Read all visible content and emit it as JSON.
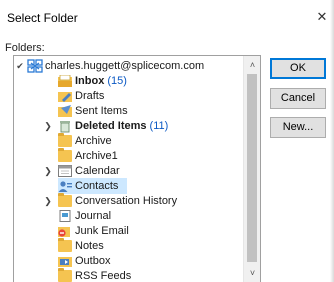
{
  "dialog": {
    "title": "Select Folder",
    "close_glyph": "✕",
    "folders_label": "Folders:"
  },
  "tree": {
    "account": "charles.huggett@splicecom.com",
    "items": [
      {
        "label": "Inbox",
        "count": "(15)",
        "bold": true,
        "icon": "inbox-icon"
      },
      {
        "label": "Drafts",
        "count": "",
        "bold": false,
        "icon": "drafts-icon"
      },
      {
        "label": "Sent Items",
        "count": "",
        "bold": false,
        "icon": "sent-items-icon"
      },
      {
        "label": "Deleted Items",
        "count": "(11)",
        "bold": true,
        "icon": "deleted-items-icon"
      },
      {
        "label": "Archive",
        "count": "",
        "bold": false,
        "icon": "folder-icon"
      },
      {
        "label": "Archive1",
        "count": "",
        "bold": false,
        "icon": "folder-icon"
      },
      {
        "label": "Calendar",
        "count": "",
        "bold": false,
        "icon": "calendar-icon"
      },
      {
        "label": "Contacts",
        "count": "",
        "bold": false,
        "icon": "contacts-icon",
        "selected": true
      },
      {
        "label": "Conversation History",
        "count": "",
        "bold": false,
        "icon": "folder-icon"
      },
      {
        "label": "Journal",
        "count": "",
        "bold": false,
        "icon": "journal-icon"
      },
      {
        "label": "Junk Email",
        "count": "",
        "bold": false,
        "icon": "junk-email-icon"
      },
      {
        "label": "Notes",
        "count": "",
        "bold": false,
        "icon": "folder-icon"
      },
      {
        "label": "Outbox",
        "count": "",
        "bold": false,
        "icon": "outbox-icon"
      },
      {
        "label": "RSS Feeds",
        "count": "",
        "bold": false,
        "icon": "folder-icon"
      }
    ]
  },
  "buttons": {
    "ok": "OK",
    "cancel": "Cancel",
    "new": "New..."
  },
  "colors": {
    "selection": "#cde8ff",
    "count_blue": "#0b59c4",
    "folder_yellow": "#f5c451",
    "primary_border": "#0078d7"
  }
}
